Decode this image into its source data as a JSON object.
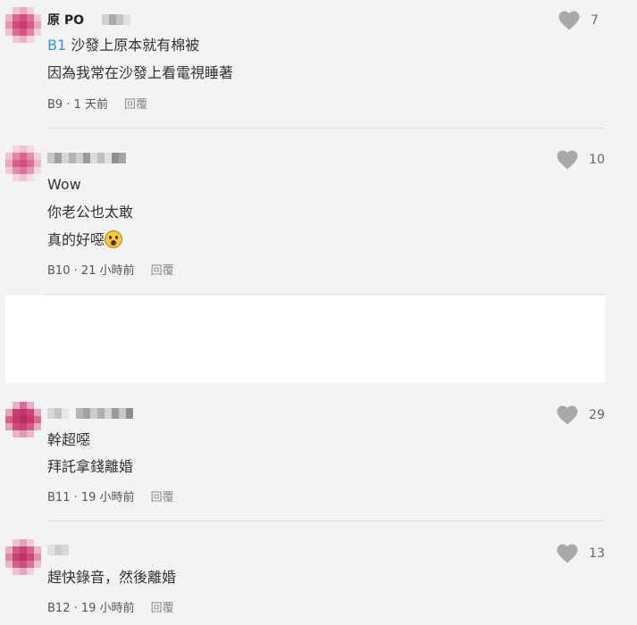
{
  "comments": [
    {
      "author": "原 PO",
      "lines": [
        "沙發上原本就有棉被",
        "因為我常在沙發上看電視睡著"
      ],
      "floor_ref": "B1",
      "floor": "B9",
      "time": "1 天前",
      "reply": "回覆",
      "likes": "7"
    },
    {
      "author": "",
      "lines": [
        "Wow",
        "你老公也太敢",
        "真的好噁"
      ],
      "floor": "B10",
      "time": "21 小時前",
      "reply": "回覆",
      "likes": "10"
    },
    {
      "author": "",
      "lines": [
        "幹超噁",
        "拜託拿錢離婚"
      ],
      "floor": "B11",
      "time": "19 小時前",
      "reply": "回覆",
      "likes": "29"
    },
    {
      "author": "",
      "lines": [
        "趕快錄音，然後離婚"
      ],
      "floor": "B12",
      "time": "19 小時前",
      "reply": "回覆",
      "likes": "13"
    }
  ],
  "colors": {
    "background": "#f3f3f3",
    "floor_ref": "#3397cf",
    "heart": "#a8a8a8",
    "avatar_pink": "#d85a8a"
  },
  "icons": {
    "like": "heart-icon",
    "emoji": "surprised-face-emoji"
  }
}
